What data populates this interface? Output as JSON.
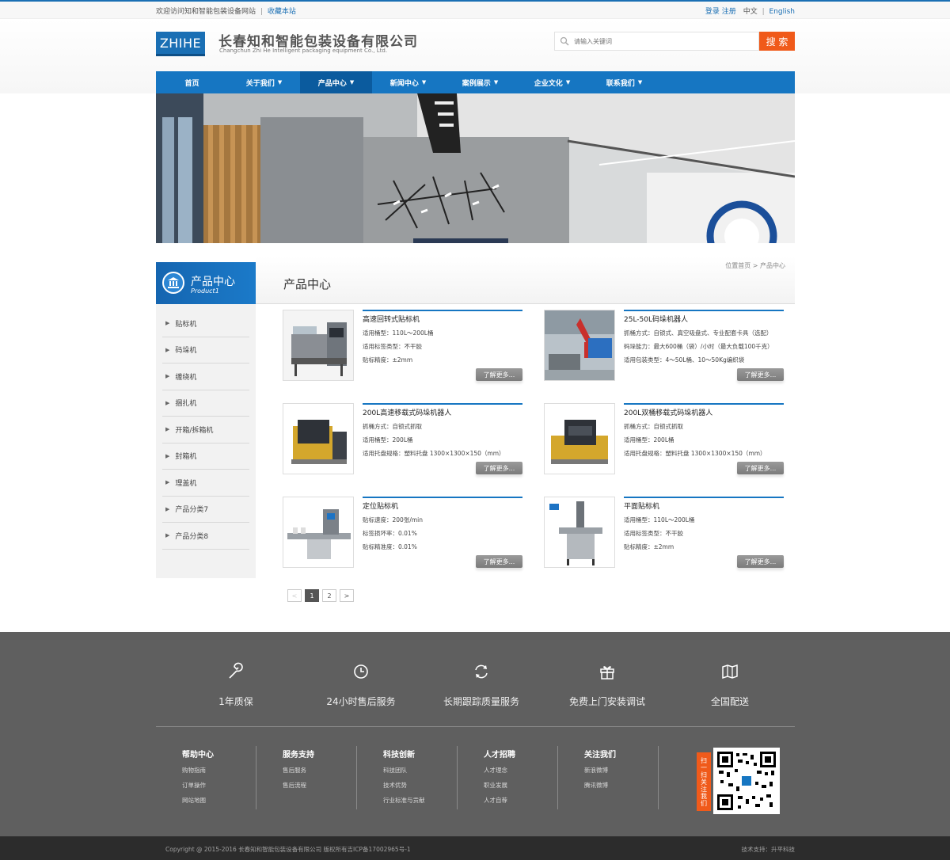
{
  "topbar": {
    "welcome": "欢迎访问知和智能包装设备网站",
    "bookmark": "收藏本站",
    "login": "登录",
    "register": "注册",
    "lang_cn": "中文",
    "lang_en": "English"
  },
  "header": {
    "logo": "ZHIHE",
    "company_cn": "长春知和智能包装设备有限公司",
    "company_en": "Changchun Zhi He Intelligent packaging equipment Co., Ltd.",
    "search_placeholder": "请输入关键词",
    "search_button": "搜 索"
  },
  "nav": [
    {
      "label": "首页",
      "caret": false,
      "active": false
    },
    {
      "label": "关于我们",
      "caret": true,
      "active": false
    },
    {
      "label": "产品中心",
      "caret": true,
      "active": true
    },
    {
      "label": "新闻中心",
      "caret": true,
      "active": false
    },
    {
      "label": "案例展示",
      "caret": true,
      "active": false
    },
    {
      "label": "企业文化",
      "caret": true,
      "active": false
    },
    {
      "label": "联系我们",
      "caret": true,
      "active": false
    }
  ],
  "sidebar": {
    "title": "产品中心",
    "subtitle": "Product1",
    "items": [
      "贴标机",
      "码垛机",
      "缠绕机",
      "捆扎机",
      "开箱/拆箱机",
      "封箱机",
      "理盖机",
      "产品分类7",
      "产品分类8"
    ]
  },
  "main": {
    "title": "产品中心",
    "breadcrumb": "位置首页 > 产品中心"
  },
  "products": [
    {
      "name": "高速回转式贴标机",
      "lines": [
        "适用桶型：110L～200L桶",
        "适用标签类型：不干胶",
        "贴标精度：±2mm"
      ],
      "more": "了解更多..."
    },
    {
      "name": "25L-50L码垛机器人",
      "lines": [
        "抓桶方式：自锁式、真空吸盘式、专业配套卡具（选配）",
        "码垛能力：最大600桶（袋）/小时（最大负载100千克）",
        "适用包装类型：4～50L桶、10～50Kg编织袋"
      ],
      "more": "了解更多..."
    },
    {
      "name": "200L高速移载式码垛机器人",
      "lines": [
        "抓桶方式：自锁式抓取",
        "适用桶型：200L桶",
        "适用托盘规格：塑料托盘 1300×1300×150（mm）"
      ],
      "more": "了解更多..."
    },
    {
      "name": "200L双桶移载式码垛机器人",
      "lines": [
        "抓桶方式：自锁式抓取",
        "适用桶型：200L桶",
        "适用托盘规格：塑料托盘 1300×1300×150（mm）"
      ],
      "more": "了解更多..."
    },
    {
      "name": "定位贴标机",
      "lines": [
        "贴标速度：200张/min",
        "标签损坏率：0.01%",
        "贴标精准度：0.01%"
      ],
      "more": "了解更多..."
    },
    {
      "name": "平面贴标机",
      "lines": [
        "适用桶型：110L～200L桶",
        "适用标签类型：不干胶",
        "贴标精度：±2mm"
      ],
      "more": "了解更多..."
    }
  ],
  "pager": {
    "prev": "<",
    "pages": [
      "1",
      "2"
    ],
    "next": ">"
  },
  "services": [
    {
      "icon": "wrench-icon",
      "label": "1年质保"
    },
    {
      "icon": "clock-icon",
      "label": "24小时售后服务"
    },
    {
      "icon": "refresh-icon",
      "label": "长期跟踪质量服务"
    },
    {
      "icon": "gift-icon",
      "label": "免费上门安装调试"
    },
    {
      "icon": "map-icon",
      "label": "全国配送"
    }
  ],
  "footer_cols": [
    {
      "title": "帮助中心",
      "links": [
        "购物指南",
        "订单操作",
        "网站地图"
      ]
    },
    {
      "title": "服务支持",
      "links": [
        "售后服务",
        "售后流程"
      ]
    },
    {
      "title": "科技创新",
      "links": [
        "科技团队",
        "技术优势",
        "行业标准与贡献"
      ]
    },
    {
      "title": "人才招聘",
      "links": [
        "人才理念",
        "职业发展",
        "人才自荐"
      ]
    },
    {
      "title": "关注我们",
      "links": [
        "新浪微博",
        "腾讯微博"
      ]
    }
  ],
  "qr_label": "扫一扫关注我们",
  "copyright": "Copyright @ 2015-2016 长春知和智能包装设备有限公司 版权所有吉ICP备17002965号-1",
  "tech_support": "技术支持：升平科技",
  "colors": {
    "primary": "#1676c2",
    "accent": "#f05a1a",
    "footer": "#5f5f5f"
  }
}
